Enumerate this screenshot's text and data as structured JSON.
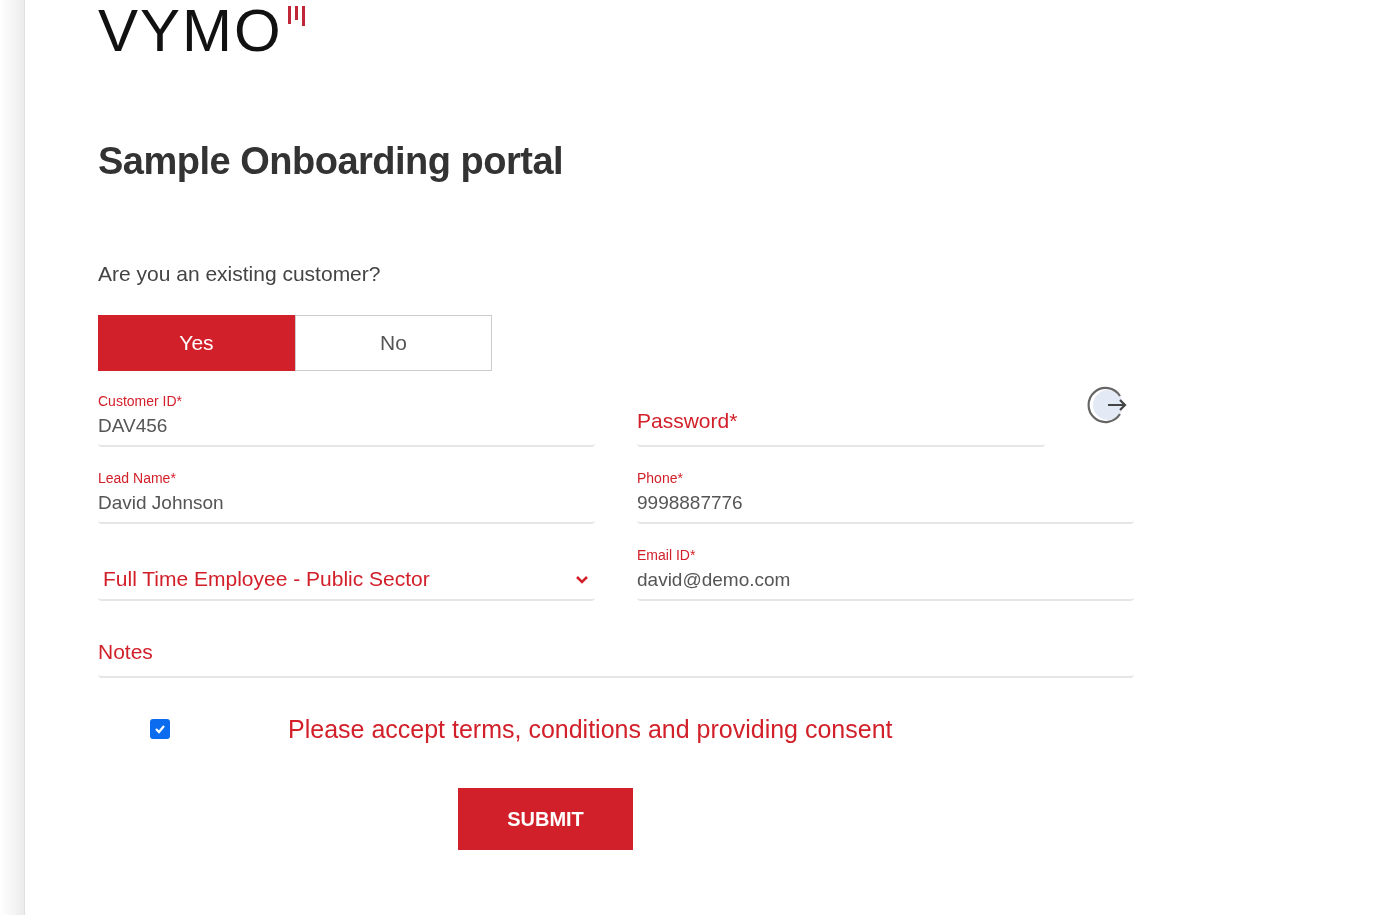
{
  "logo": "VYMO",
  "title": "Sample Onboarding portal",
  "question": "Are you an existing customer?",
  "choices": [
    {
      "label": "Yes",
      "selected": true
    },
    {
      "label": "No",
      "selected": false
    }
  ],
  "rows": [
    [
      {
        "kind": "filled",
        "label": "Customer ID*",
        "value": "DAV456"
      },
      {
        "kind": "password",
        "label": "Password*"
      }
    ],
    [
      {
        "kind": "filled",
        "label": "Lead Name*",
        "value": "David Johnson"
      },
      {
        "kind": "filled",
        "label": "Phone*",
        "value": "9998887776"
      }
    ],
    [
      {
        "kind": "select",
        "value": "Full Time Employee - Public Sector"
      },
      {
        "kind": "filled",
        "label": "Email ID*",
        "value": "david@demo.com"
      }
    ],
    [
      {
        "kind": "empty",
        "label": "Notes"
      }
    ]
  ],
  "consent": {
    "checked": true,
    "text": "Please accept terms, conditions and providing consent"
  },
  "submit": "SUBMIT"
}
